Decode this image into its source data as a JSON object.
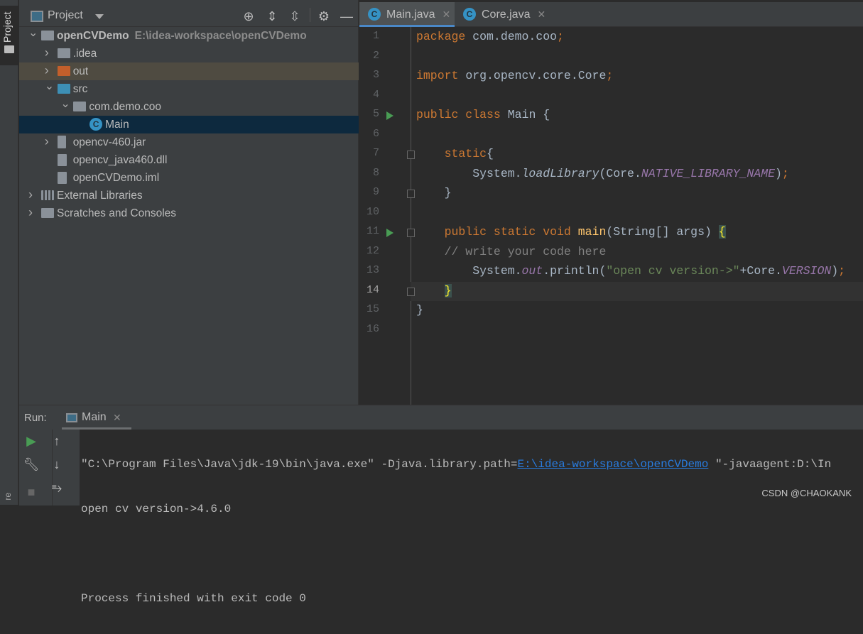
{
  "sidebar_stripe": {
    "project_tab": "Project",
    "bottom_label": "re"
  },
  "project_panel": {
    "title": "Project",
    "toolbar_icons": [
      "locate-icon",
      "expand-all-icon",
      "collapse-all-icon",
      "gear-icon",
      "hide-icon"
    ],
    "tree": [
      {
        "label": "openCVDemo",
        "path": "E:\\idea-workspace\\openCVDemo",
        "depth": 0,
        "expanded": true,
        "icon": "module-folder",
        "bold": true
      },
      {
        "label": ".idea",
        "depth": 1,
        "expanded": false,
        "icon": "folder"
      },
      {
        "label": "out",
        "depth": 1,
        "expanded": false,
        "icon": "excluded-folder"
      },
      {
        "label": "src",
        "depth": 1,
        "expanded": true,
        "icon": "source-folder"
      },
      {
        "label": "com.demo.coo",
        "depth": 2,
        "expanded": true,
        "icon": "package"
      },
      {
        "label": "Main",
        "depth": 3,
        "icon": "java-class",
        "selected": true
      },
      {
        "label": "opencv-460.jar",
        "depth": 1,
        "expanded": false,
        "icon": "jar"
      },
      {
        "label": "opencv_java460.dll",
        "depth": 1,
        "icon": "unknown-file"
      },
      {
        "label": "openCVDemo.iml",
        "depth": 1,
        "icon": "iml-file"
      },
      {
        "label": "External Libraries",
        "depth": 0,
        "expanded": false,
        "icon": "libraries"
      },
      {
        "label": "Scratches and Consoles",
        "depth": 0,
        "expanded": false,
        "icon": "scratches"
      }
    ]
  },
  "editor": {
    "tabs": [
      {
        "label": "Main.java",
        "active": true
      },
      {
        "label": "Core.java",
        "active": false
      }
    ],
    "current_line": 14,
    "lines": [
      [
        {
          "t": "package ",
          "c": "kw"
        },
        {
          "t": "com.demo.coo"
        },
        {
          "t": ";",
          "c": "kw"
        }
      ],
      [],
      [
        {
          "t": "import ",
          "c": "kw"
        },
        {
          "t": "org.opencv.core.Core"
        },
        {
          "t": ";",
          "c": "kw"
        }
      ],
      [],
      [
        {
          "t": "public class ",
          "c": "kw"
        },
        {
          "t": "Main {"
        }
      ],
      [],
      [
        {
          "t": "    static",
          "c": "kw"
        },
        {
          "t": "{"
        }
      ],
      [
        {
          "t": "        System."
        },
        {
          "t": "loadLibrary",
          "c": "it"
        },
        {
          "t": "(Core."
        },
        {
          "t": "NATIVE_LIBRARY_NAME",
          "c": "cst"
        },
        {
          "t": ")"
        },
        {
          "t": ";",
          "c": "kw"
        }
      ],
      [
        {
          "t": "    }"
        }
      ],
      [],
      [
        {
          "t": "    public static void ",
          "c": "kw"
        },
        {
          "t": "main",
          "c": "fn"
        },
        {
          "t": "(String[] args) "
        },
        {
          "t": "{",
          "c": "brc"
        }
      ],
      [
        {
          "t": "    // write your code here",
          "c": "cm"
        }
      ],
      [
        {
          "t": "        System."
        },
        {
          "t": "out",
          "c": "cst"
        },
        {
          "t": ".println("
        },
        {
          "t": "\"open cv version->\"",
          "c": "str"
        },
        {
          "t": "+Core."
        },
        {
          "t": "VERSION",
          "c": "cst"
        },
        {
          "t": ")"
        },
        {
          "t": ";",
          "c": "kw"
        }
      ],
      [
        {
          "t": "    "
        },
        {
          "t": "}",
          "c": "brc"
        }
      ],
      [
        {
          "t": "}"
        }
      ],
      []
    ],
    "run_gutter_lines": [
      5,
      11
    ],
    "fold_lines": [
      7,
      9,
      11,
      14
    ]
  },
  "run_panel": {
    "label": "Run:",
    "tab": "Main",
    "console": {
      "line1_pre": "\"C:\\Program Files\\Java\\jdk-19\\bin\\java.exe\" -Djava.library.path=",
      "line1_link": "E:\\idea-workspace\\openCVDemo",
      "line1_post": " \"-javaagent:D:\\In",
      "line2": "open cv version->4.6.0",
      "line3": "",
      "line4": "Process finished with exit code 0"
    }
  },
  "watermark": "CSDN @CHAOKANK",
  "colors": {
    "keyword": "#cc7832",
    "method": "#ffc66d",
    "constant": "#9876aa",
    "string": "#6a8759",
    "comment": "#808080",
    "link": "#287bde",
    "run": "#499c54",
    "selection": "#0d293e"
  }
}
